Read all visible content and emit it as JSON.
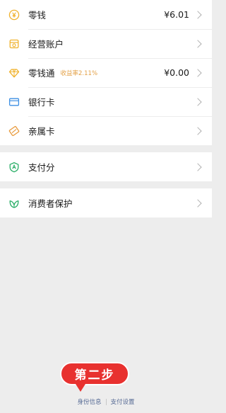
{
  "wallet": {
    "change": {
      "label": "零钱",
      "value": "¥6.01",
      "icon": "yuan-coin-icon"
    },
    "business_account": {
      "label": "经营账户",
      "icon": "business-account-icon"
    },
    "licaitong": {
      "label": "零钱通",
      "badge": "收益率2.11%",
      "value": "¥0.00",
      "icon": "diamond-icon"
    },
    "bank_card": {
      "label": "银行卡",
      "icon": "bank-card-icon"
    },
    "family_card": {
      "label": "亲属卡",
      "icon": "family-card-icon"
    }
  },
  "score": {
    "label": "支付分",
    "icon": "pay-score-icon"
  },
  "protection": {
    "label": "消费者保护",
    "icon": "consumer-protection-icon"
  },
  "footer": {
    "identity": "身份信息",
    "settings": "支付设置"
  },
  "annotation": {
    "step_label": "第二步"
  },
  "colors": {
    "yellow": "#f0b22d",
    "blue": "#3d8fe3",
    "green": "#2aae67",
    "orange": "#e89a3c",
    "link": "#576b95",
    "stamp_red": "#e8312f"
  }
}
